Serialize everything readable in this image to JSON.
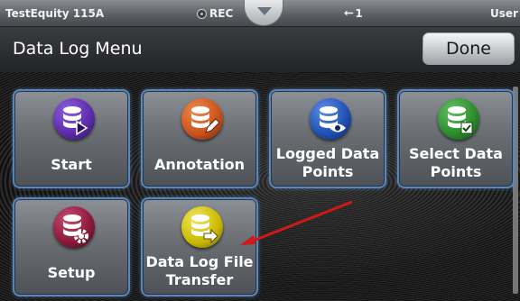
{
  "statusbar": {
    "title": "TestEquity 115A",
    "rec_label": "REC",
    "usb_label": "1",
    "user_label": "User"
  },
  "header": {
    "title": "Data Log Menu",
    "done_label": "Done"
  },
  "tiles": [
    {
      "label": "Start",
      "icon": "database-play-icon",
      "color": "#5a2aa8"
    },
    {
      "label": "Annotation",
      "icon": "database-pencil-icon",
      "color": "#c8501c"
    },
    {
      "label": "Logged Data Points",
      "icon": "database-eye-icon",
      "color": "#1e4fb0"
    },
    {
      "label": "Select Data Points",
      "icon": "database-check-icon",
      "color": "#2a8a2a"
    },
    {
      "label": "Setup",
      "icon": "database-gear-icon",
      "color": "#8a1838"
    },
    {
      "label": "Data Log File Transfer",
      "icon": "database-transfer-icon",
      "color": "#c9b800"
    }
  ],
  "annotation_arrow_color": "#d01818"
}
